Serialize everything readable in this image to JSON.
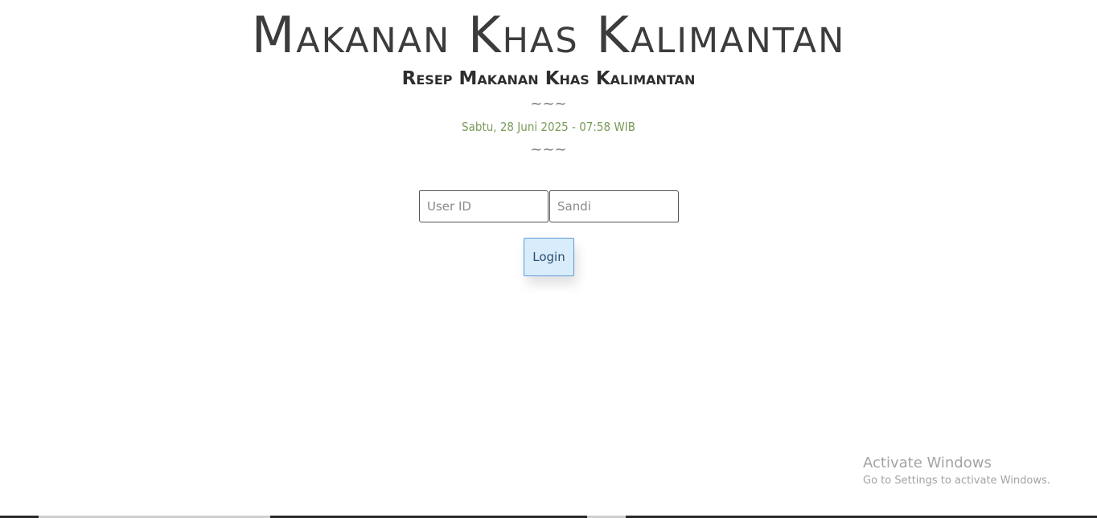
{
  "header": {
    "title": "Makanan Khas Kalimantan",
    "subtitle": "Resep Makanan Khas Kalimantan",
    "divider_top": "~~~",
    "datetime": "Sabtu, 28 Juni 2025 - 07:58 WIB",
    "divider_bottom": "~~~"
  },
  "login_form": {
    "userid_placeholder": "User ID",
    "password_placeholder": "Sandi",
    "login_label": "Login"
  },
  "watermark": {
    "title": "Activate Windows",
    "subtitle": "Go to Settings to activate Windows."
  },
  "colors": {
    "datetime": "#7a9a5a",
    "button_bg": "#d9ecfc",
    "button_border": "#5b9bd5"
  }
}
